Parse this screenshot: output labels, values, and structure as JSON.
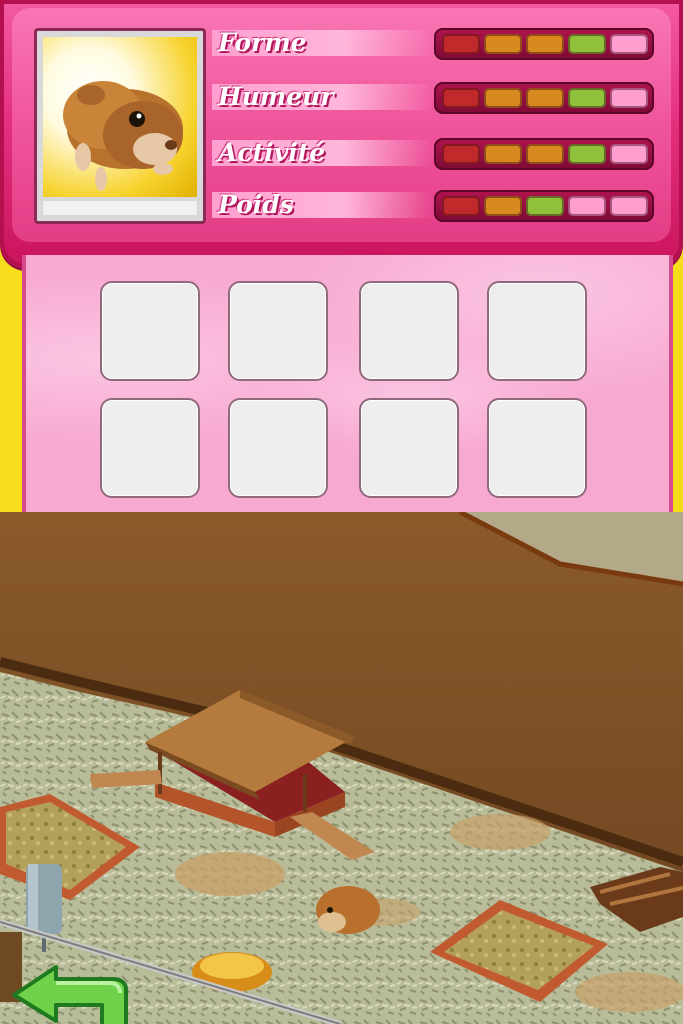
{
  "pet": {
    "portrait_icon": "guinea-pig-portrait"
  },
  "stats": [
    {
      "label": "Forme",
      "level": 4,
      "max": 5
    },
    {
      "label": "Humeur",
      "level": 4,
      "max": 5
    },
    {
      "label": "Activité",
      "level": 4,
      "max": 5
    },
    {
      "label": "Poids",
      "level": 3,
      "max": 5
    }
  ],
  "inventory": {
    "slots_total": 8,
    "filled": 0
  },
  "scene": {
    "objects": [
      "hutch",
      "ramp",
      "sandbox-left",
      "sandbox-right",
      "water-bottle",
      "food-bowl",
      "guinea-pig",
      "wood-pile"
    ]
  },
  "controls": {
    "back_icon": "back-arrow-icon"
  },
  "colors": {
    "panel_pink": "#e5307f",
    "seg_red": "#c02a2a",
    "seg_orange": "#d98a1e",
    "seg_green": "#8fc23a",
    "seg_empty": "#ff9fd0"
  }
}
